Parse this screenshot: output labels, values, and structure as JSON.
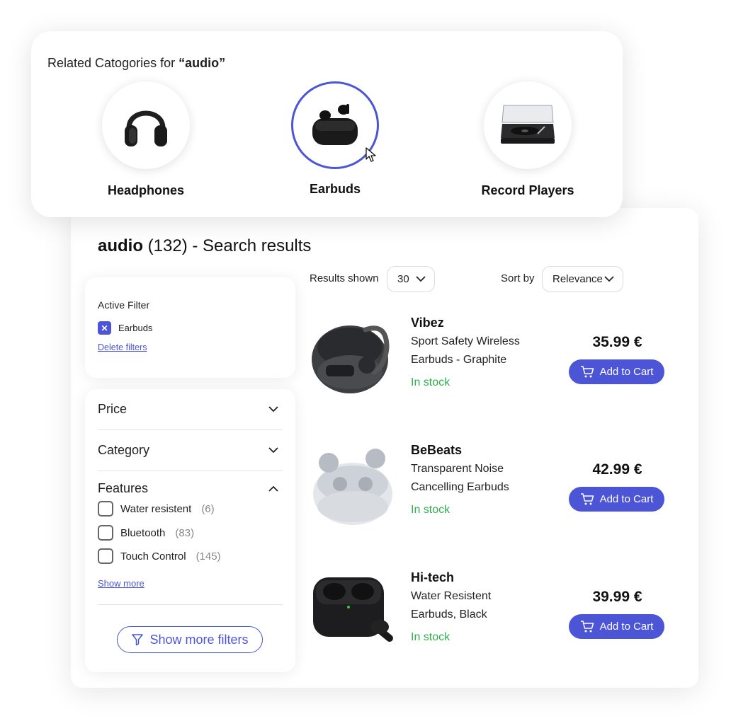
{
  "related": {
    "title_prefix": "Related Catogories for ",
    "query_quoted": "“audio”",
    "categories": [
      {
        "label": "Headphones",
        "icon": "headphones-icon",
        "selected": false
      },
      {
        "label": "Earbuds",
        "icon": "earbuds-icon",
        "selected": true
      },
      {
        "label": "Record Players",
        "icon": "record-player-icon",
        "selected": false
      }
    ]
  },
  "results": {
    "query": "audio",
    "count_text": " (132) - Search results",
    "results_shown_label": "Results shown",
    "results_shown_value": "30",
    "sort_label": "Sort by",
    "sort_value": "Relevance"
  },
  "filters": {
    "active_label": "Active Filter",
    "active_items": [
      "Earbuds"
    ],
    "delete_label": "Delete filters",
    "facets": [
      {
        "label": "Price",
        "open": false
      },
      {
        "label": "Category",
        "open": false
      },
      {
        "label": "Features",
        "open": true
      }
    ],
    "features": [
      {
        "label": "Water resistent",
        "count": "(6)",
        "checked": false
      },
      {
        "label": "Bluetooth",
        "count": "(83)",
        "checked": false
      },
      {
        "label": "Touch Control",
        "count": "(145)",
        "checked": false
      }
    ],
    "show_more_label": "Show more",
    "more_filters_label": "Show more filters"
  },
  "products": [
    {
      "brand": "Vibez",
      "name_line1": "Sport Safety Wireless",
      "name_line2": "Earbuds - Graphite",
      "stock": "In stock",
      "price": "35.99 €",
      "cta": "Add to Cart"
    },
    {
      "brand": "BeBeats",
      "name_line1": "Transparent Noise",
      "name_line2": "Cancelling Earbuds",
      "stock": "In stock",
      "price": "42.99 €",
      "cta": "Add to Cart"
    },
    {
      "brand": "Hi-tech",
      "name_line1": "Water Resistent",
      "name_line2": "Earbuds, Black",
      "stock": "In stock",
      "price": "39.99 €",
      "cta": "Add to Cart"
    }
  ],
  "colors": {
    "accent": "#4b55d6",
    "in_stock": "#2fb14a"
  }
}
